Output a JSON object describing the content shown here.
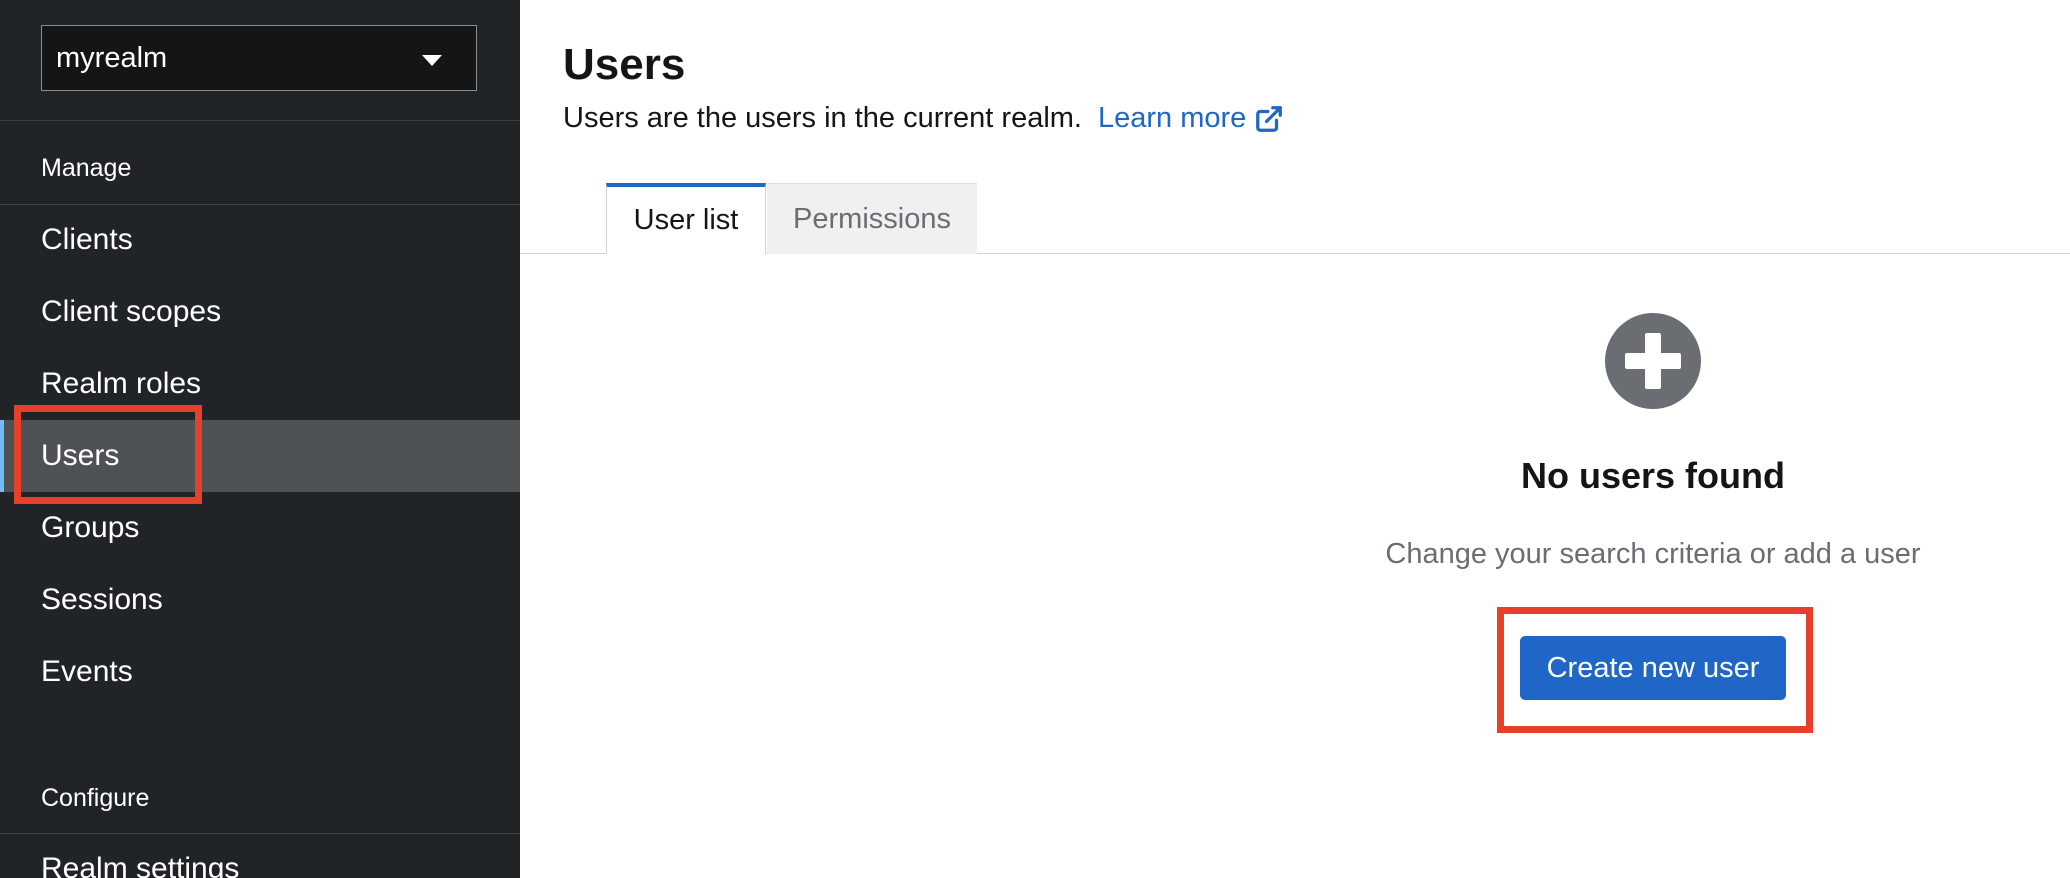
{
  "realm_selector": {
    "value": "myrealm"
  },
  "sidebar": {
    "manage_title": "Manage",
    "items": [
      {
        "label": "Clients"
      },
      {
        "label": "Client scopes"
      },
      {
        "label": "Realm roles"
      },
      {
        "label": "Users",
        "active": true
      },
      {
        "label": "Groups"
      },
      {
        "label": "Sessions"
      },
      {
        "label": "Events"
      }
    ],
    "configure_title": "Configure",
    "configure_items": [
      {
        "label": "Realm settings"
      }
    ]
  },
  "header": {
    "title": "Users",
    "description": "Users are the users in the current realm.",
    "learn_more": "Learn more"
  },
  "tabs": [
    {
      "label": "User list",
      "active": true
    },
    {
      "label": "Permissions",
      "active": false
    }
  ],
  "empty_state": {
    "title": "No users found",
    "body": "Change your search criteria or add a user",
    "button": "Create new user"
  },
  "colors": {
    "accent": "#1f66c7",
    "highlight": "#e5402a",
    "sidebar_bg": "#212427"
  }
}
